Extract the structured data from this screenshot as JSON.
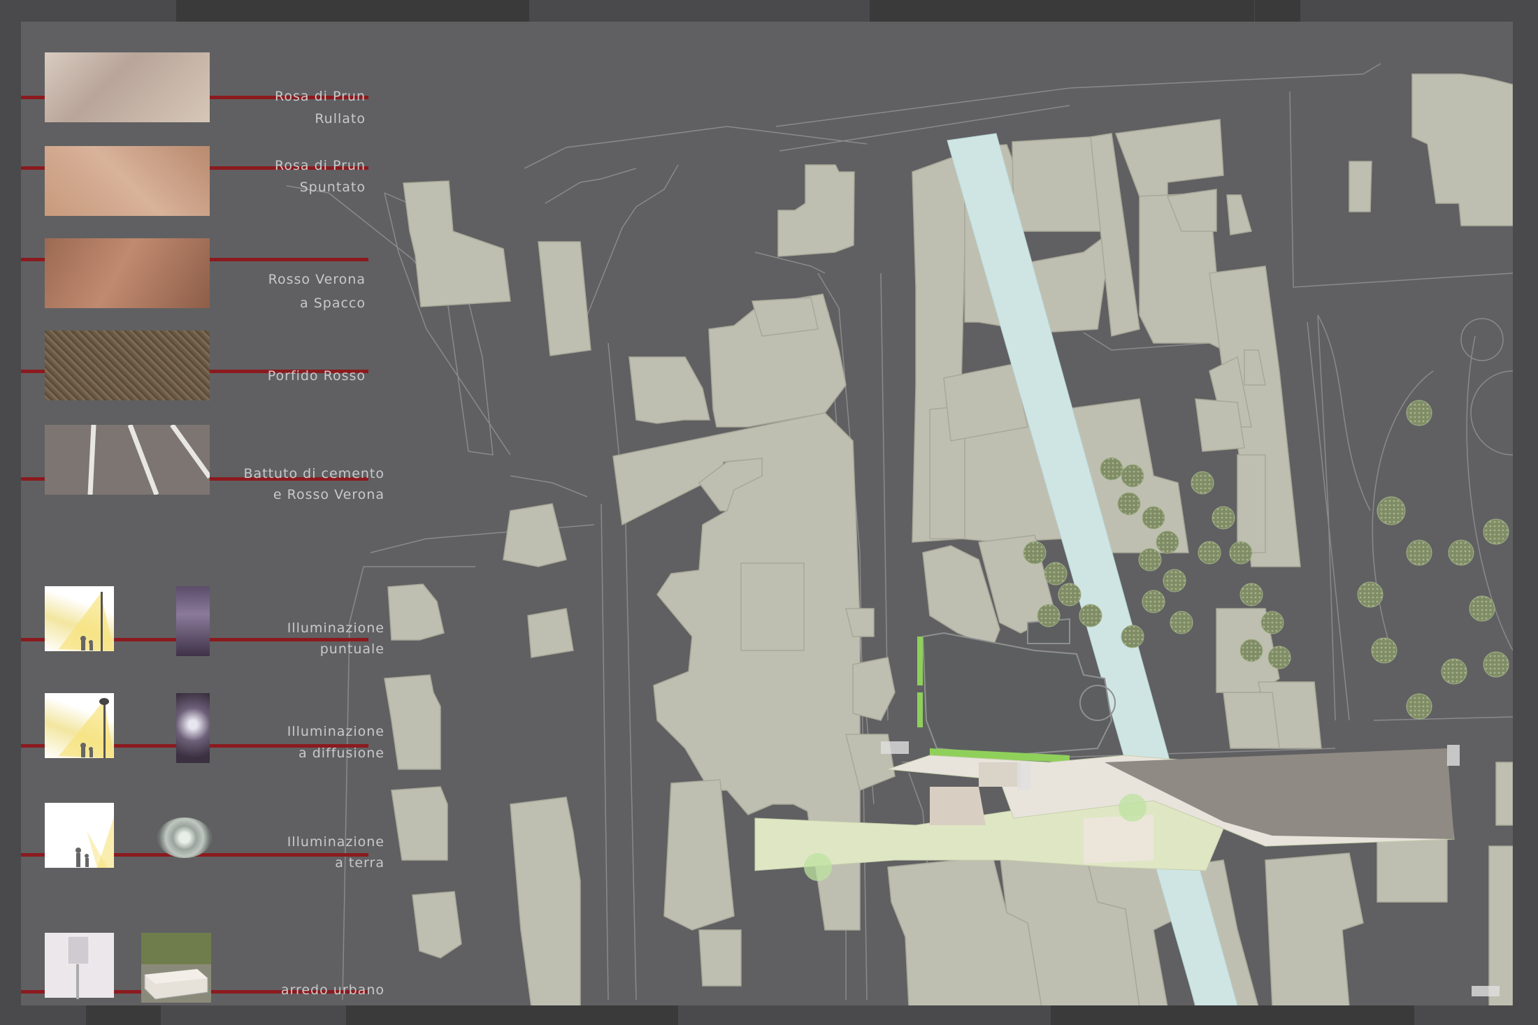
{
  "legend": {
    "materials": [
      {
        "line1": "Rosa di Prun",
        "line2": "Rullato",
        "swatch": "rosa-prun-rullato",
        "color": "#cdbcae"
      },
      {
        "line1": "Rosa di Prun",
        "line2": "Spuntato",
        "swatch": "rosa-prun-spuntato",
        "color": "#c79b7e"
      },
      {
        "line1": "Rosso Verona",
        "line2": "a Spacco",
        "swatch": "rosso-verona-spacco",
        "color": "#b07a60"
      },
      {
        "line1": "Porfido Rosso",
        "line2": "",
        "swatch": "porfido-rosso",
        "color": "#6c5a44"
      },
      {
        "line1": "Battuto di cemento",
        "line2": "e Rosso Verona",
        "swatch": "battuto-cemento",
        "color": "#7c7572"
      }
    ],
    "lighting": [
      {
        "line1": "Illuminazione",
        "line2": "puntuale",
        "icon": "street-lamp-icon"
      },
      {
        "line1": "Illuminazione",
        "line2": "a diffusione",
        "icon": "globe-lamp-icon"
      },
      {
        "line1": "Illuminazione",
        "line2": "a terra",
        "icon": "ground-light-icon"
      }
    ],
    "furniture": {
      "line1": "arredo urbano",
      "icon": "bench-icon"
    }
  },
  "colors": {
    "background": "#606062",
    "frame": "#4a4a4c",
    "building": "#bfbfb1",
    "canal": "#cfe5e4",
    "legend_line": "#8b1a1e",
    "plaza": "#e8e4dc",
    "plaza_green": "#dfe6c4",
    "parking": "#8f8a83",
    "grass": "#8fd05a"
  }
}
